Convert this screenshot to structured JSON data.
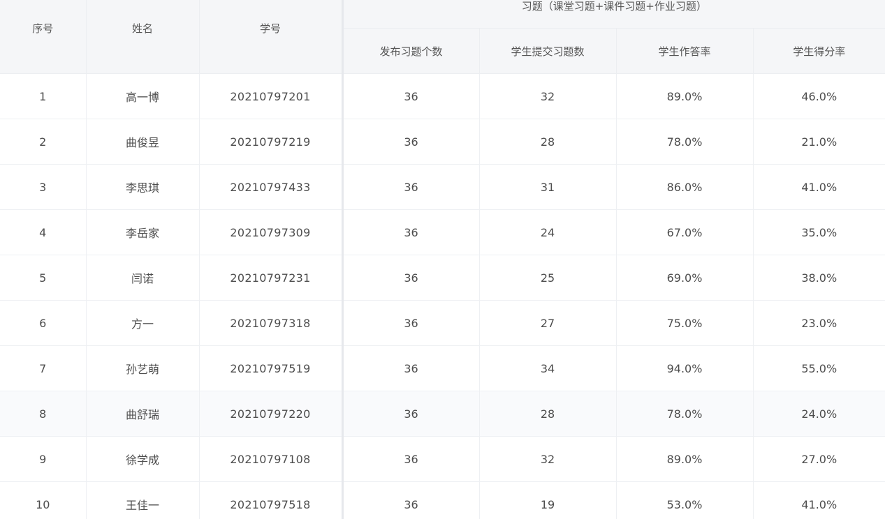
{
  "headers": {
    "index": "序号",
    "name": "姓名",
    "student_id": "学号",
    "group": "习题（课堂习题+课件习题+作业习题）",
    "published": "发布习题个数",
    "submitted": "学生提交习题数",
    "answer_rate": "学生作答率",
    "score_rate": "学生得分率"
  },
  "rows": [
    {
      "index": "1",
      "name": "高一博",
      "student_id": "20210797201",
      "published": "36",
      "submitted": "32",
      "answer_rate": "89.0%",
      "score_rate": "46.0%"
    },
    {
      "index": "2",
      "name": "曲俊昱",
      "student_id": "20210797219",
      "published": "36",
      "submitted": "28",
      "answer_rate": "78.0%",
      "score_rate": "21.0%"
    },
    {
      "index": "3",
      "name": "李思琪",
      "student_id": "20210797433",
      "published": "36",
      "submitted": "31",
      "answer_rate": "86.0%",
      "score_rate": "41.0%"
    },
    {
      "index": "4",
      "name": "李岳家",
      "student_id": "20210797309",
      "published": "36",
      "submitted": "24",
      "answer_rate": "67.0%",
      "score_rate": "35.0%"
    },
    {
      "index": "5",
      "name": "闫诺",
      "student_id": "20210797231",
      "published": "36",
      "submitted": "25",
      "answer_rate": "69.0%",
      "score_rate": "38.0%"
    },
    {
      "index": "6",
      "name": "方一",
      "student_id": "20210797318",
      "published": "36",
      "submitted": "27",
      "answer_rate": "75.0%",
      "score_rate": "23.0%"
    },
    {
      "index": "7",
      "name": "孙艺萌",
      "student_id": "20210797519",
      "published": "36",
      "submitted": "34",
      "answer_rate": "94.0%",
      "score_rate": "55.0%"
    },
    {
      "index": "8",
      "name": "曲舒瑞",
      "student_id": "20210797220",
      "published": "36",
      "submitted": "28",
      "answer_rate": "78.0%",
      "score_rate": "24.0%"
    },
    {
      "index": "9",
      "name": "徐学成",
      "student_id": "20210797108",
      "published": "36",
      "submitted": "32",
      "answer_rate": "89.0%",
      "score_rate": "27.0%"
    },
    {
      "index": "10",
      "name": "王佳一",
      "student_id": "20210797518",
      "published": "36",
      "submitted": "19",
      "answer_rate": "53.0%",
      "score_rate": "41.0%"
    }
  ]
}
